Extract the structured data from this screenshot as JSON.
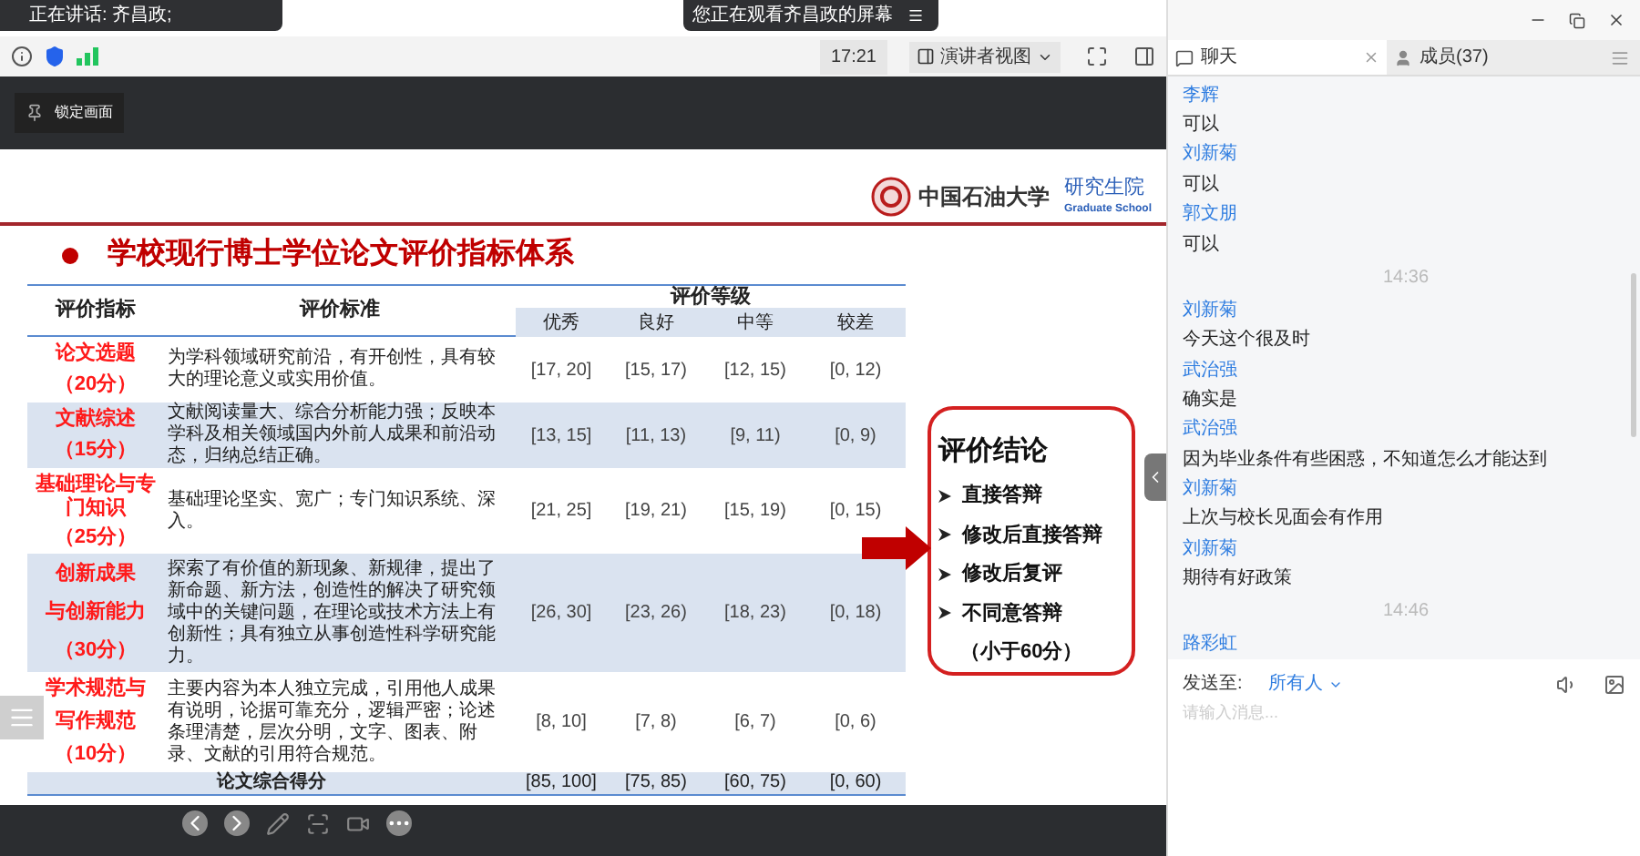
{
  "toasts": {
    "speaking": "正在讲话: 齐昌政;",
    "viewing": "您正在观看齐昌政的屏幕"
  },
  "toolbar": {
    "time": "17:21",
    "view_mode": "演讲者视图"
  },
  "lock_button": "锁定画面",
  "slide": {
    "logo_text": "中国石油大学",
    "school": "研究生院",
    "school_en": "Graduate School",
    "title": "学校现行博士学位论文评价指标体系",
    "table": {
      "col_indicator": "评价指标",
      "col_criteria": "评价标准",
      "col_grade": "评价等级",
      "grades": [
        "优秀",
        "良好",
        "中等",
        "较差"
      ],
      "rows": [
        {
          "indicator": [
            "论文选题"
          ],
          "points": "（20分）",
          "criteria": "为学科领域研究前沿，有开创性，具有较大的理论意义或实用价值。",
          "ranges": [
            "[17, 20]",
            "[15, 17)",
            "[12, 15)",
            "[0, 12)"
          ]
        },
        {
          "indicator": [
            "文献综述"
          ],
          "points": "（15分）",
          "criteria": "文献阅读量大、综合分析能力强；反映本学科及相关领域国内外前人成果和前沿动态，归纳总结正确。",
          "ranges": [
            "[13, 15]",
            "[11, 13)",
            "[9, 11)",
            "[0, 9)"
          ]
        },
        {
          "indicator": [
            "基础理论与专门知识"
          ],
          "points": "（25分）",
          "criteria": "基础理论坚实、宽广；专门知识系统、深入。",
          "ranges": [
            "[21, 25]",
            "[19, 21)",
            "[15, 19)",
            "[0, 15)"
          ]
        },
        {
          "indicator": [
            "创新成果",
            "与创新能力"
          ],
          "points": "（30分）",
          "criteria": "探索了有价值的新现象、新规律，提出了新命题、新方法，创造性的解决了研究领域中的关键问题，在理论或技术方法上有创新性；具有独立从事创造性科学研究能力。",
          "ranges": [
            "[26, 30]",
            "[23, 26)",
            "[18, 23)",
            "[0, 18)"
          ]
        },
        {
          "indicator": [
            "学术规范与",
            "写作规范"
          ],
          "points": "（10分）",
          "criteria": "主要内容为本人独立完成，引用他人成果有说明，论据可靠充分，逻辑严密；论述条理清楚，层次分明，文字、图表、附录、文献的引用符合规范。",
          "ranges": [
            "[8, 10]",
            "[7, 8)",
            "[6, 7)",
            "[0, 6)"
          ]
        }
      ],
      "total": {
        "label": "论文综合得分",
        "ranges": [
          "[85, 100]",
          "[75, 85)",
          "[60, 75)",
          "[0, 60)"
        ]
      }
    },
    "conclusion": {
      "title": "评价结论",
      "items": [
        {
          "kind": "option",
          "text": "直接答辩"
        },
        {
          "kind": "option",
          "text": "修改后直接答辩"
        },
        {
          "kind": "option",
          "text": "修改后复评"
        },
        {
          "kind": "option",
          "text": "不同意答辩"
        },
        {
          "kind": "note",
          "text": "（小于60分）"
        }
      ]
    }
  },
  "chat_panel": {
    "tabs": [
      {
        "label": "聊天",
        "selected": true
      },
      {
        "label": "成员(37)",
        "selected": false
      }
    ],
    "feed": [
      {
        "kind": "message",
        "sender": "李辉",
        "text": "可以"
      },
      {
        "kind": "message",
        "sender": "刘新菊",
        "text": "可以"
      },
      {
        "kind": "message",
        "sender": "郭文朋",
        "text": "可以"
      },
      {
        "kind": "time",
        "text": "14:36"
      },
      {
        "kind": "message",
        "sender": "刘新菊",
        "text": "今天这个很及时"
      },
      {
        "kind": "message",
        "sender": "武治强",
        "text": "确实是"
      },
      {
        "kind": "message",
        "sender": "武治强",
        "text": "因为毕业条件有些困惑，不知道怎么才能达到"
      },
      {
        "kind": "message",
        "sender": "刘新菊",
        "text": "上次与校长见面会有作用"
      },
      {
        "kind": "message",
        "sender": "刘新菊",
        "text": "期待有好政策"
      },
      {
        "kind": "time",
        "text": "14:46"
      },
      {
        "kind": "message",
        "sender": "路彩虹"
      }
    ],
    "send_to_label": "发送至:",
    "recipient": "所有人",
    "input": {
      "placeholder": "请输入消息..."
    }
  }
}
